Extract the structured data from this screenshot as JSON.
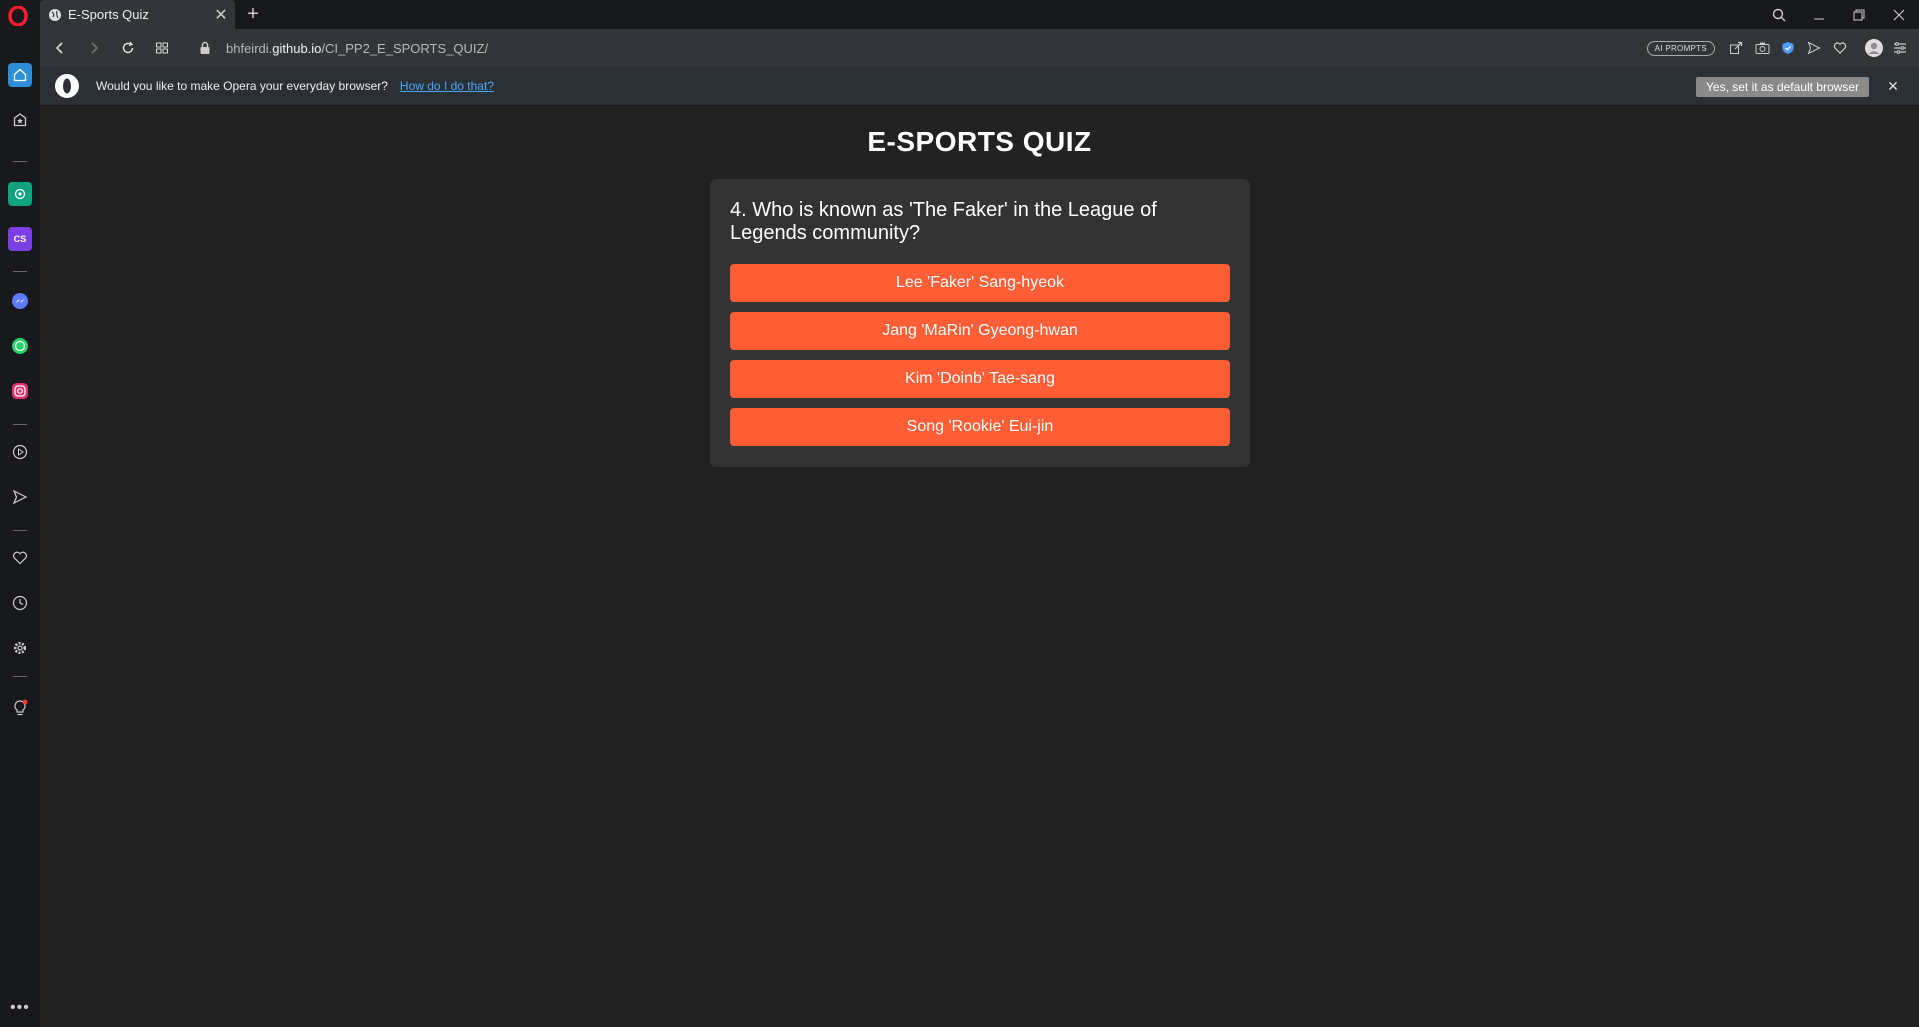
{
  "browser": {
    "tab": {
      "title": "E-Sports Quiz"
    },
    "address": {
      "url_prefix": "bhfeirdi.",
      "url_domain": "github.io",
      "url_path": "/CI_PP2_E_SPORTS_QUIZ/"
    },
    "ai_prompts_label": "AI PROMPTS",
    "infobar": {
      "message": "Would you like to make Opera your everyday browser?",
      "link": "How do I do that?",
      "default_button": "Yes, set it as default browser"
    }
  },
  "page": {
    "title": "E-SPORTS QUIZ",
    "question": "4. Who is known as 'The Faker' in the League of Legends community?",
    "answers": [
      "Lee 'Faker' Sang-hyeok",
      "Jang 'MaRin' Gyeong-hwan",
      "Kim 'Doinb' Tae-sang",
      "Song 'Rookie' Eui-jin"
    ]
  },
  "colors": {
    "accent": "#ff5d35",
    "background": "#222222",
    "card": "#333333"
  }
}
